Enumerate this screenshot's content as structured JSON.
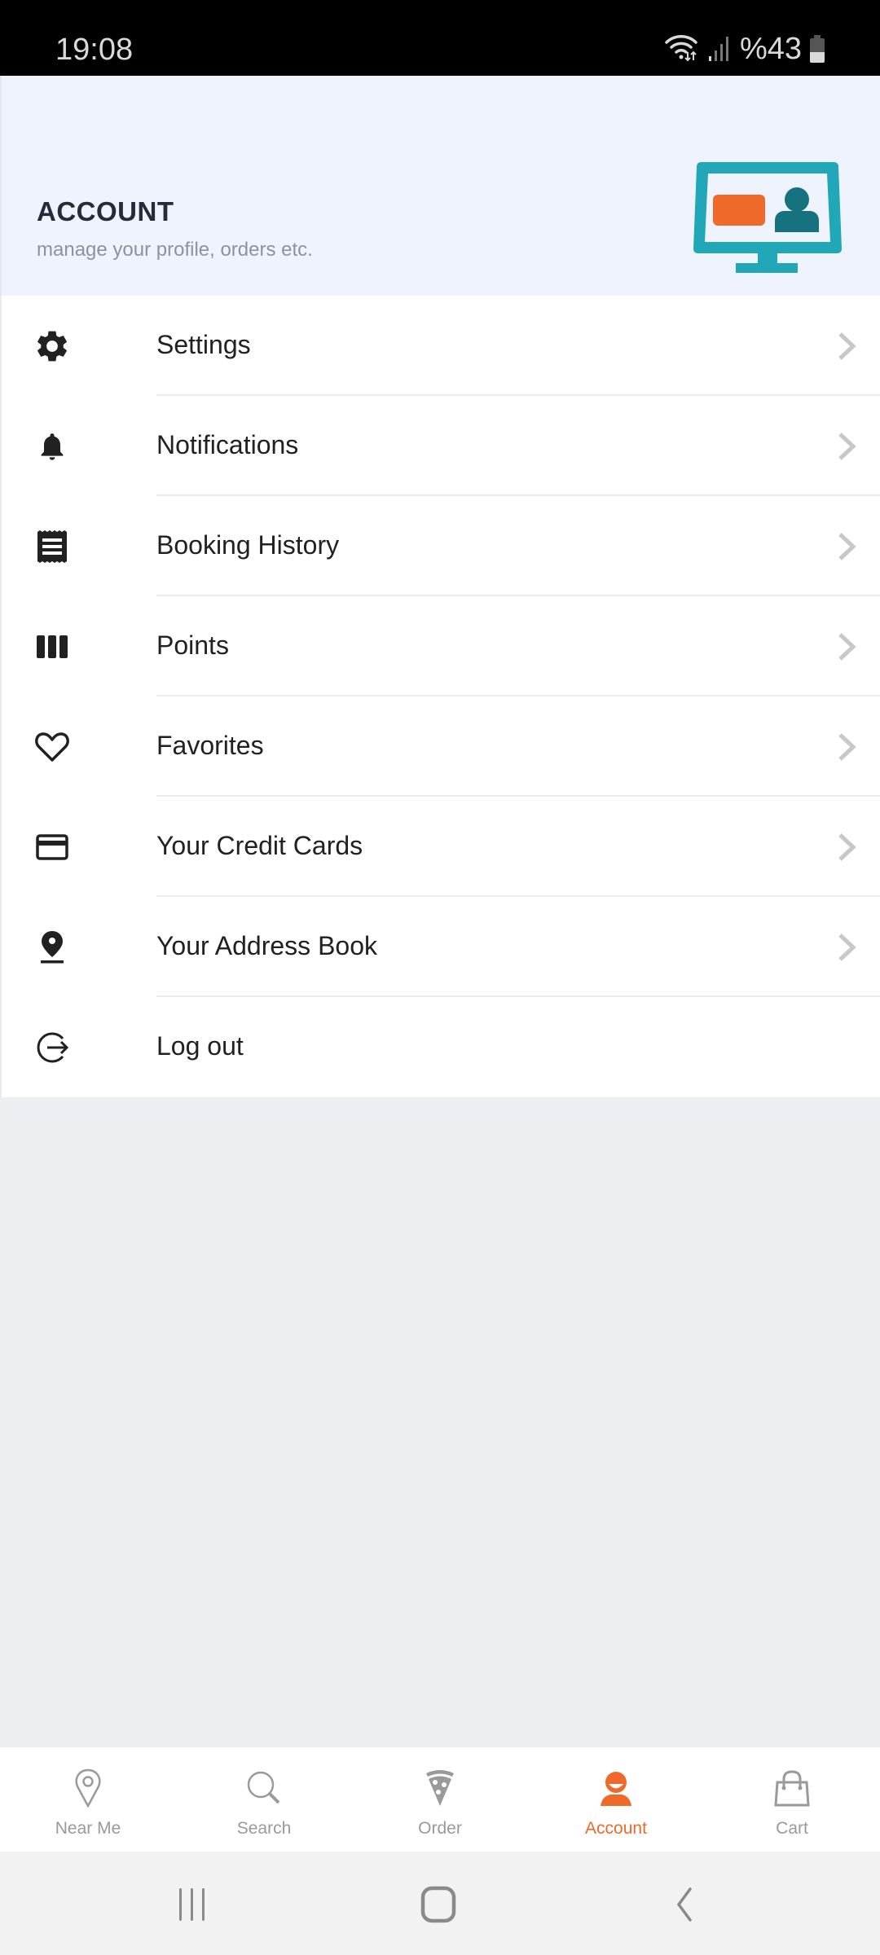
{
  "status_bar": {
    "time": "19:08",
    "battery_text": "%43",
    "battery_level_percent": 43,
    "icons": [
      "wifi-icon",
      "signal-icon",
      "battery-icon"
    ]
  },
  "header": {
    "title": "ACCOUNT",
    "subtitle": "manage your profile, orders etc.",
    "illustration": "monitor-profile-illustration"
  },
  "menu": {
    "items": [
      {
        "label": "Settings",
        "icon": "gear-icon",
        "has_chevron": true
      },
      {
        "label": "Notifications",
        "icon": "bell-icon",
        "has_chevron": true
      },
      {
        "label": "Booking History",
        "icon": "receipt-icon",
        "has_chevron": true
      },
      {
        "label": "Points",
        "icon": "columns-icon",
        "has_chevron": true
      },
      {
        "label": "Favorites",
        "icon": "heart-icon",
        "has_chevron": true
      },
      {
        "label": "Your Credit Cards",
        "icon": "credit-card-icon",
        "has_chevron": true
      },
      {
        "label": "Your Address Book",
        "icon": "location-pin-icon",
        "has_chevron": true
      },
      {
        "label": "Log out",
        "icon": "logout-icon",
        "has_chevron": false
      }
    ]
  },
  "bottom_nav": {
    "items": [
      {
        "label": "Near Me",
        "icon": "map-pin-icon",
        "active": false
      },
      {
        "label": "Search",
        "icon": "search-icon",
        "active": false
      },
      {
        "label": "Order",
        "icon": "pizza-icon",
        "active": false
      },
      {
        "label": "Account",
        "icon": "user-icon",
        "active": true
      },
      {
        "label": "Cart",
        "icon": "shopping-bag-icon",
        "active": false
      }
    ]
  },
  "system_nav": {
    "buttons": [
      "recent-apps",
      "home",
      "back"
    ]
  },
  "colors": {
    "accent": "#ef6a2a",
    "header_bg": "#eff3fd",
    "page_bg": "#eceef1",
    "text_primary": "#212121",
    "title": "#262b3a",
    "inactive_nav": "#9a9a9a",
    "illustration_teal": "#22a7b8",
    "illustration_dark_teal": "#17727f"
  }
}
